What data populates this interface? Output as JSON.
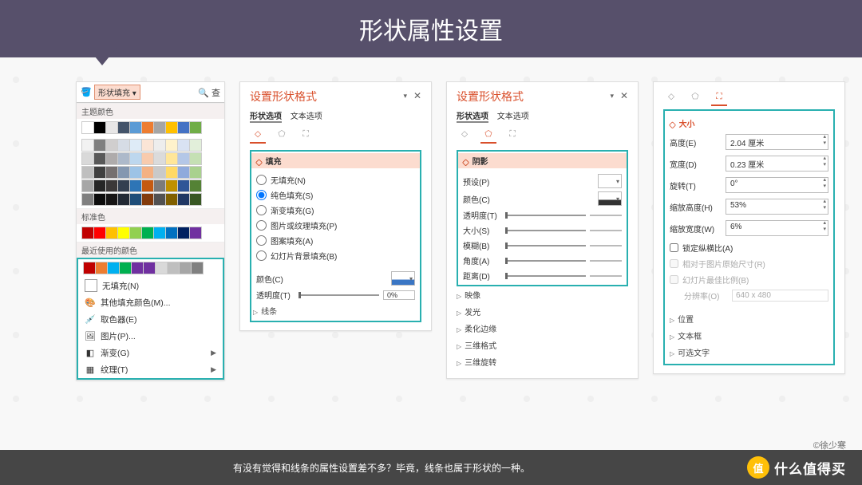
{
  "title": "形状属性设置",
  "panel1": {
    "tab_label": "形状填充",
    "search_label": "查",
    "theme_label": "主题颜色",
    "standard_label": "标准色",
    "recent_label": "最近使用的颜色",
    "theme_row1": [
      "#ffffff",
      "#000000",
      "#e7e6e6",
      "#44546a",
      "#5b9bd5",
      "#ed7d31",
      "#a5a5a5",
      "#ffc000",
      "#4472c4",
      "#70ad47"
    ],
    "theme_grays": [
      [
        "#f2f2f2",
        "#808080",
        "#d0cece",
        "#d6dce5",
        "#deebf7",
        "#fbe5d6",
        "#ededed",
        "#fff2cc",
        "#d9e2f3",
        "#e2efda"
      ],
      [
        "#d9d9d9",
        "#595959",
        "#aeabab",
        "#adb9ca",
        "#bdd7ee",
        "#f8cbad",
        "#dbdbdb",
        "#ffe699",
        "#b4c7e7",
        "#c5e0b4"
      ],
      [
        "#bfbfbf",
        "#404040",
        "#757070",
        "#8497b0",
        "#9dc3e6",
        "#f4b183",
        "#c9c9c9",
        "#ffd966",
        "#8faadc",
        "#a9d18e"
      ],
      [
        "#a6a6a6",
        "#262626",
        "#3b3838",
        "#333f50",
        "#2e75b6",
        "#c55a11",
        "#7b7b7b",
        "#bf9000",
        "#2f5597",
        "#548235"
      ],
      [
        "#7f7f7f",
        "#0d0d0d",
        "#171616",
        "#222a35",
        "#1f4e79",
        "#843c0c",
        "#525252",
        "#806000",
        "#203864",
        "#385723"
      ]
    ],
    "standard_row": [
      "#c00000",
      "#ff0000",
      "#ffc000",
      "#ffff00",
      "#92d050",
      "#00b050",
      "#00b0f0",
      "#0070c0",
      "#002060",
      "#7030a0"
    ],
    "recent_row": [
      "#c00000",
      "#ed7d31",
      "#00b0f0",
      "#00b050",
      "#7030a0",
      "#7030a0",
      "#d9d9d9",
      "#bfbfbf",
      "#a6a6a6",
      "#808080"
    ],
    "no_fill": "无填充(N)",
    "more_colors": "其他填充颜色(M)...",
    "eyedropper": "取色器(E)",
    "picture": "图片(P)...",
    "gradient": "渐变(G)",
    "texture": "纹理(T)"
  },
  "panel2": {
    "title": "设置形状格式",
    "tab_shape": "形状选项",
    "tab_text": "文本选项",
    "section": "填充",
    "opts": {
      "none": "无填充(N)",
      "solid": "纯色填充(S)",
      "grad": "渐变填充(G)",
      "pict": "图片或纹理填充(P)",
      "patt": "图案填充(A)",
      "slide": "幻灯片背景填充(B)"
    },
    "color_lbl": "颜色(C)",
    "trans_lbl": "透明度(T)",
    "trans_val": "0%",
    "line_section": "线条"
  },
  "panel3": {
    "title": "设置形状格式",
    "tab_shape": "形状选项",
    "tab_text": "文本选项",
    "section": "阴影",
    "preset": "预设(P)",
    "color": "颜色(C)",
    "trans": "透明度(T)",
    "size": "大小(S)",
    "blur": "模糊(B)",
    "angle": "角度(A)",
    "dist": "距离(D)",
    "others": [
      "映像",
      "发光",
      "柔化边缘",
      "三维格式",
      "三维旋转"
    ]
  },
  "panel4": {
    "section": "大小",
    "height_lbl": "高度(E)",
    "height_val": "2.04 厘米",
    "width_lbl": "宽度(D)",
    "width_val": "0.23 厘米",
    "rot_lbl": "旋转(T)",
    "rot_val": "0°",
    "sh_lbl": "缩放高度(H)",
    "sh_val": "53%",
    "sw_lbl": "缩放宽度(W)",
    "sw_val": "6%",
    "lock": "锁定纵横比(A)",
    "orig": "相对于图片原始尺寸(R)",
    "best": "幻灯片最佳比例(B)",
    "res_lbl": "分辨率(O)",
    "res_val": "640 x 480",
    "others": [
      "位置",
      "文本框",
      "可选文字"
    ]
  },
  "credit": "©徐少寒",
  "footer": "有没有觉得和线条的属性设置差不多？毕竟，线条也属于形状的一种。",
  "brand_badge": "值",
  "brand": "什么值得买"
}
